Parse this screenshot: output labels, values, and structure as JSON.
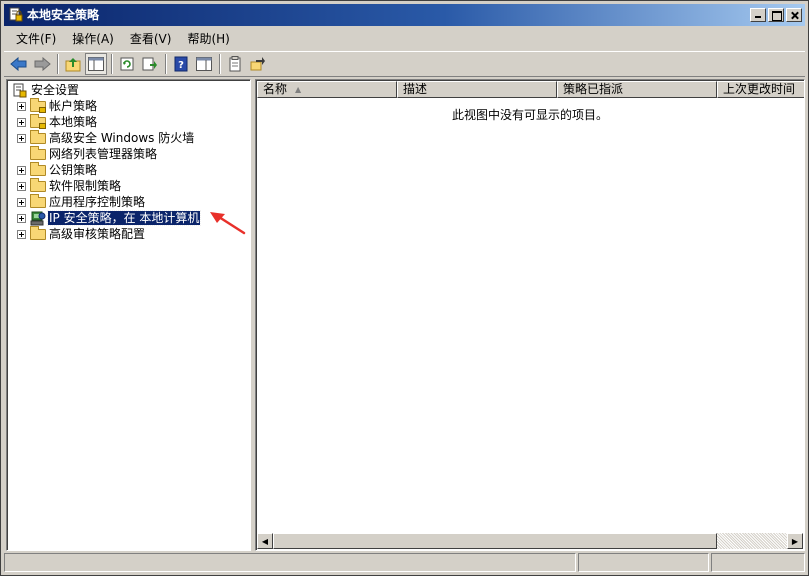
{
  "window": {
    "title": "本地安全策略"
  },
  "menu": [
    {
      "label": "文件(F)"
    },
    {
      "label": "操作(A)"
    },
    {
      "label": "查看(V)"
    },
    {
      "label": "帮助(H)"
    }
  ],
  "toolbar": {
    "icons": [
      "back-arrow-icon",
      "forward-arrow-icon",
      "up-folder-icon",
      "show-tree-icon",
      "refresh-icon",
      "export-list-icon",
      "help-icon",
      "properties-view-icon",
      "new-policy-icon",
      "manage-filters-icon"
    ]
  },
  "tree": {
    "items": [
      {
        "label": "安全设置",
        "icon": "security-settings-icon",
        "expander": false,
        "level": 0
      },
      {
        "label": "帐户策略",
        "icon": "folder-lock-icon",
        "expander": true,
        "level": 1
      },
      {
        "label": "本地策略",
        "icon": "folder-lock-icon",
        "expander": true,
        "level": 1
      },
      {
        "label": "高级安全 Windows 防火墙",
        "icon": "folder-icon",
        "expander": true,
        "level": 1
      },
      {
        "label": "网络列表管理器策略",
        "icon": "folder-icon",
        "expander": false,
        "level": 1
      },
      {
        "label": "公钥策略",
        "icon": "folder-icon",
        "expander": true,
        "level": 1
      },
      {
        "label": "软件限制策略",
        "icon": "folder-icon",
        "expander": true,
        "level": 1
      },
      {
        "label": "应用程序控制策略",
        "icon": "folder-icon",
        "expander": true,
        "level": 1
      },
      {
        "label": "IP 安全策略，在 本地计算机",
        "icon": "ip-security-icon",
        "expander": true,
        "level": 1,
        "selected": true
      },
      {
        "label": "高级审核策略配置",
        "icon": "folder-icon",
        "expander": true,
        "level": 1
      }
    ]
  },
  "list": {
    "columns": [
      {
        "label": "名称",
        "sorted": true
      },
      {
        "label": "描述"
      },
      {
        "label": "策略已指派"
      },
      {
        "label": "上次更改时间"
      }
    ],
    "empty_message": "此视图中没有可显示的项目。"
  },
  "colors": {
    "title_gradient_start": "#0a246a",
    "title_gradient_end": "#a6caf0",
    "selection": "#0a246a",
    "annotation_arrow": "#e8302a"
  }
}
